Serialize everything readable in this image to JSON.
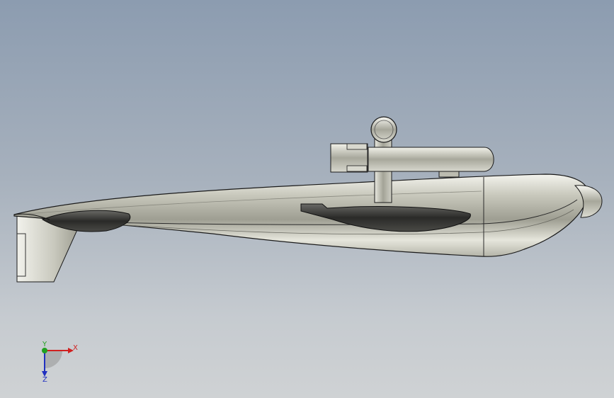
{
  "viewport": {
    "background_top": "#8c9cb0",
    "background_bottom": "#cfd2d4"
  },
  "model": {
    "hull_color": "#d6d6cc",
    "edge_color": "#1a1a1a",
    "fin_color": "#3a3a3a"
  },
  "triad": {
    "x_label": "X",
    "y_label": "Y",
    "z_label": "Z",
    "x_color": "#d02020",
    "y_color": "#20a020",
    "z_color": "#2030c0"
  }
}
